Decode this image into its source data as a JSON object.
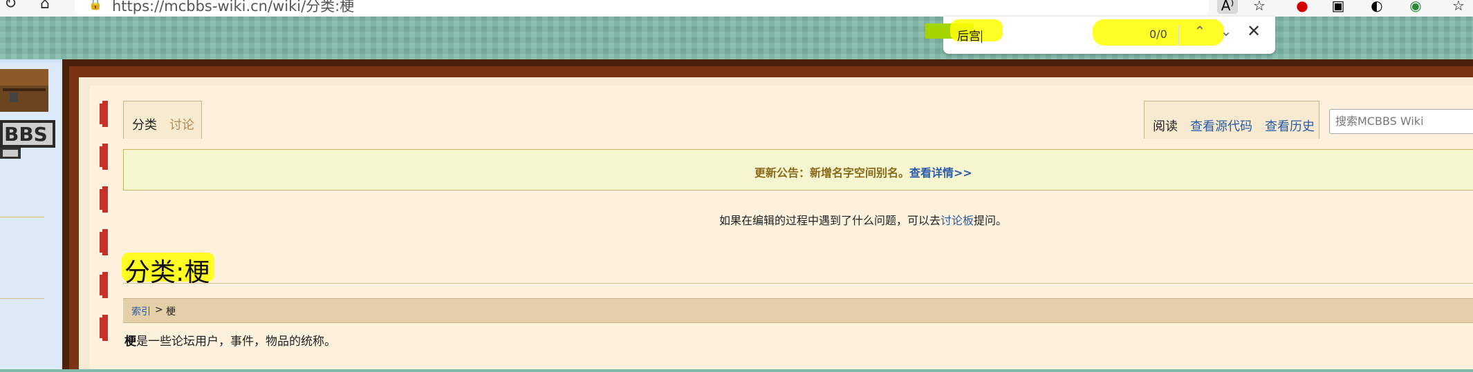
{
  "browser": {
    "url": "https://mcbbs-wiki.cn/wiki/分类:梗",
    "find": {
      "query": "后宫",
      "count": "0/0"
    }
  },
  "wiki": {
    "tabs_left": [
      {
        "label": "分类"
      },
      {
        "label": "讨论"
      }
    ],
    "tabs_right": [
      {
        "label": "阅读"
      },
      {
        "label": "查看源代码"
      },
      {
        "label": "查看历史"
      }
    ],
    "search_placeholder": "搜索MCBBS Wiki",
    "notice": {
      "text": "更新公告：新增名字空间别名。",
      "link": "查看详情>>"
    },
    "edit_note": {
      "before": "如果在编辑的过程中遇到了什么问题，可以去",
      "link": "讨论板",
      "after": "提问。"
    },
    "page_title": "分类:梗",
    "breadcrumb": {
      "root": "索引",
      "sep": ">",
      "current": "梗"
    },
    "description": {
      "bold": "梗",
      "rest": "是一些论坛用户，事件，物品的统称。"
    }
  },
  "colors": {
    "highlight": "#ffff00",
    "find_match": "#a3d600",
    "link": "#2b5aa8",
    "frame": "#7b3313"
  }
}
